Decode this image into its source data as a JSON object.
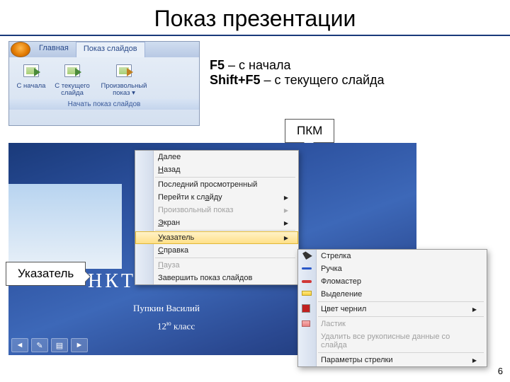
{
  "title": "Показ презентации",
  "ribbon": {
    "tab_home": "Главная",
    "tab_slideshow": "Показ слайдов",
    "btn_from_start": "С начала",
    "btn_from_current": "С текущего слайда",
    "btn_custom": "Произвольный показ ▾",
    "group_label": "Начать показ слайдов"
  },
  "instructions": {
    "f5_key": "F5",
    "f5_text": " – с начала",
    "shift_key": "Shift+F5",
    "shift_text": " – с текущего слайда"
  },
  "callouts": {
    "pkm": "ПКМ",
    "pointer": "Указатель"
  },
  "slide": {
    "main": "НКТ",
    "author": "Пупкин Василий",
    "grade_num": "12",
    "grade_sup": "ю",
    "grade_tail": " класс"
  },
  "context_menu": {
    "next": "Далее",
    "next_u": "Д",
    "back": "Назад",
    "back_u": "Н",
    "last_viewed": "Последний просмотренный",
    "goto_slide": "Перейти к слайду",
    "goto_u": "а",
    "custom_show": "Произвольный показ",
    "screen": "Экран",
    "screen_u": "Э",
    "pointer": "Указатель",
    "pointer_u": "У",
    "help": "Справка",
    "help_u": "С",
    "pause": "Пауза",
    "pause_u": "П",
    "end": "Завершить показ слайдов"
  },
  "submenu": {
    "arrow": "Стрелка",
    "pen": "Ручка",
    "felt": "Фломастер",
    "highlight": "Выделение",
    "ink_color": "Цвет чернил",
    "eraser": "Ластик",
    "erase_all": "Удалить все рукописные данные со слайда",
    "arrow_options": "Параметры стрелки"
  },
  "pen_colors": {
    "pen": "#2a58c8",
    "felt": "#d03838"
  },
  "page_number": "6"
}
